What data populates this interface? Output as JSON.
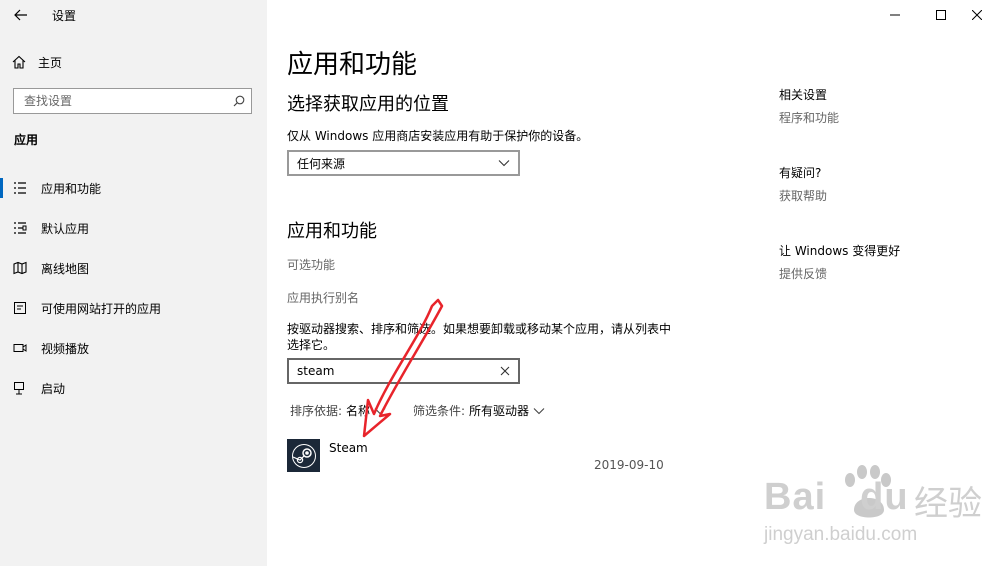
{
  "window": {
    "title": "设置",
    "controls": {
      "minimize": "minimize-icon",
      "maximize": "maximize-icon",
      "close": "close-icon"
    }
  },
  "nav": {
    "home": "主页",
    "search_placeholder": "查找设置",
    "section": "应用",
    "items": [
      {
        "label": "应用和功能",
        "icon": "apps-features-icon",
        "active": true
      },
      {
        "label": "默认应用",
        "icon": "default-apps-icon"
      },
      {
        "label": "离线地图",
        "icon": "offline-maps-icon"
      },
      {
        "label": "可使用网站打开的应用",
        "icon": "apps-for-websites-icon"
      },
      {
        "label": "视频播放",
        "icon": "video-playback-icon"
      },
      {
        "label": "启动",
        "icon": "startup-icon"
      }
    ]
  },
  "main": {
    "title": "应用和功能",
    "location": {
      "heading": "选择获取应用的位置",
      "description": "仅从 Windows 应用商店安装应用有助于保护你的设备。",
      "dropdown_value": "任何来源"
    },
    "apps": {
      "heading": "应用和功能",
      "optional_features": "可选功能",
      "app_aliases": "应用执行别名",
      "instructions_line1": "按驱动器搜索、排序和筛选。如果想要卸载或移动某个应用，请从列表中",
      "instructions_line2": "选择它。",
      "search_value": "steam",
      "sort_label": "排序依据:",
      "sort_value": "名称",
      "filter_label": "筛选条件:",
      "filter_value": "所有驱动器",
      "list": [
        {
          "name": "Steam",
          "date": "2019-09-10",
          "icon": "steam-icon"
        }
      ]
    }
  },
  "side": {
    "related_heading": "相关设置",
    "related_link": "程序和功能",
    "question_heading": "有疑问?",
    "question_link": "获取帮助",
    "improve_heading": "让 Windows 变得更好",
    "improve_link": "提供反馈"
  },
  "watermark": {
    "brand": "Bai",
    "brand_suffix": "du",
    "cn": "经验",
    "url": "jingyan.baidu.com"
  },
  "colors": {
    "accent": "#0067c0",
    "annotation_arrow": "#e8242b"
  }
}
